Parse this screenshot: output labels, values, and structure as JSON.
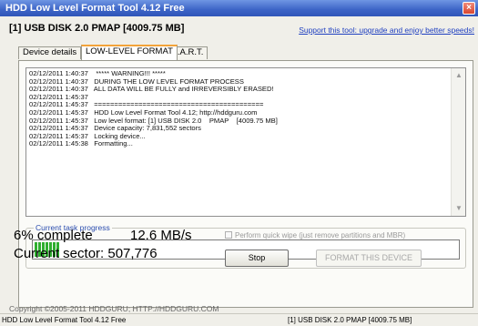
{
  "window": {
    "title": "HDD Low Level Format Tool 4.12   Free",
    "close_glyph": "×"
  },
  "header": {
    "device": "[1]  USB DISK 2.0    PMAP    [4009.75 MB]",
    "support_link": "Support this tool: upgrade and enjoy better speeds!"
  },
  "tabs": [
    {
      "label": "Device details",
      "active": false
    },
    {
      "label": "LOW-LEVEL FORMAT",
      "active": true
    },
    {
      "label": "S.M.A.R.T.",
      "active": false
    }
  ],
  "log": {
    "lines": [
      "02/12/2011 1:40:37    ***** WARNING!!! *****",
      "02/12/2011 1:40:37   DURING THE LOW LEVEL FORMAT PROCESS",
      "02/12/2011 1:40:37   ALL DATA WILL BE FULLY and IRREVERSIBLY ERASED!",
      "02/12/2011 1:45:37",
      "02/12/2011 1:45:37   ==========================================",
      "02/12/2011 1:45:37   HDD Low Level Format Tool 4.12; http://hddguru.com",
      "02/12/2011 1:45:37   Low level format: [1] USB DISK 2.0    PMAP    [4009.75 MB]",
      "02/12/2011 1:45:37   Device capacity: 7,831,552 sectors",
      "02/12/2011 1:45:37   Locking device...",
      "02/12/2011 1:45:38   Formatting..."
    ],
    "scroll_up_icon": "▲",
    "scroll_down_icon": "▼"
  },
  "progress": {
    "legend": "Current task progress",
    "fraction": 0.06,
    "color": "#2fae2f"
  },
  "stats": {
    "percent_text": "6% complete",
    "speed_text": "12.6 MB/s",
    "sector_text": "Current sector: 507,776"
  },
  "options": {
    "quick_wipe_label": "Perform quick wipe (just remove partitions and MBR)",
    "quick_wipe_checked": false
  },
  "buttons": {
    "stop": "Stop",
    "format": "FORMAT THIS DEVICE"
  },
  "footer": {
    "copyright": "Copyright ©2005-2011 HDDGURU;  HTTP://HDDGURU.COM"
  },
  "statusbar": {
    "left": "HDD Low Level Format Tool 4.12   Free",
    "right": "[1]  USB DISK 2.0    PMAP    [4009.75 MB]"
  }
}
